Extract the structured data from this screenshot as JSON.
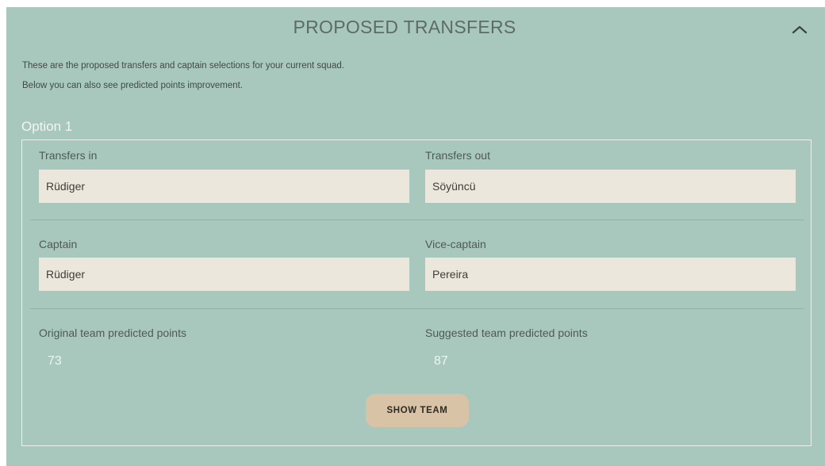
{
  "header": {
    "title": "PROPOSED TRANSFERS",
    "collapse_icon": "chevron-up-icon"
  },
  "intro": {
    "line1": "These are the proposed transfers and captain selections for your current squad.",
    "line2": "Below you can also see predicted points improvement."
  },
  "option": {
    "title": "Option 1",
    "transfers_in_label": "Transfers in",
    "transfers_in_value": "Rüdiger",
    "transfers_out_label": "Transfers out",
    "transfers_out_value": "Söyüncü",
    "captain_label": "Captain",
    "captain_value": "Rüdiger",
    "vice_captain_label": "Vice-captain",
    "vice_captain_value": "Pereira",
    "original_points_label": "Original team predicted points",
    "original_points_value": "73",
    "suggested_points_label": "Suggested team predicted points",
    "suggested_points_value": "87",
    "show_team_label": "SHOW TEAM"
  },
  "colors": {
    "panel_bg": "#a8c8be",
    "field_bg": "#ece7dc",
    "button_bg": "#d9c3a6"
  }
}
